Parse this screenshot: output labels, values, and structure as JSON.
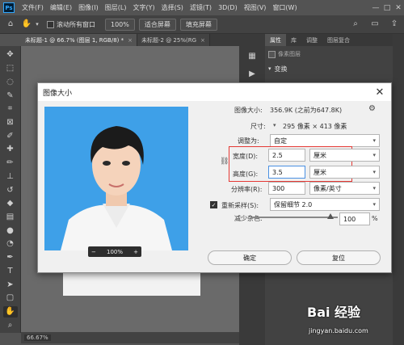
{
  "menubar": {
    "logo": "Ps",
    "items": [
      "文件(F)",
      "编辑(E)",
      "图像(I)",
      "图层(L)",
      "文字(Y)",
      "选择(S)",
      "滤镜(T)",
      "3D(D)",
      "视图(V)",
      "窗口(W)"
    ],
    "win_controls": [
      "—",
      "□",
      "✕"
    ]
  },
  "optbar": {
    "scroll_all_label": "滚动所有窗口",
    "zoom_value": "100%",
    "fit_screen": "适合屏幕",
    "fill_screen": "填充屏幕"
  },
  "tabs": [
    {
      "label": "未标题-1 @ 66.7% (图层 1, RGB/8) *",
      "close": "×"
    },
    {
      "label": "未标题-2 @ 25%(RG",
      "close": "×"
    }
  ],
  "panel": {
    "tabs": [
      "属性",
      "库",
      "调整",
      "图层复合"
    ],
    "row1": "像素图层",
    "row2": "变换"
  },
  "statusbar": {
    "zoom": "66.67%"
  },
  "dialog": {
    "title": "图像大小",
    "close": "✕",
    "image_size_label": "图像大小:",
    "image_size_value": "356.9K (之前为647.8K)",
    "dimensions_label": "尺寸:",
    "dimensions_value": "295 像素 × 413 像素",
    "fit_to_label": "调整为:",
    "fit_to_value": "自定",
    "width_label": "宽度(D):",
    "width_value": "2.5",
    "width_unit": "厘米",
    "height_label": "高度(G):",
    "height_value": "3.5",
    "height_unit": "厘米",
    "resolution_label": "分辨率(R):",
    "resolution_value": "300",
    "resolution_unit": "像素/英寸",
    "resample_label": "重新采样(S):",
    "resample_value": "保留细节 2.0",
    "noise_label": "减少杂色:",
    "noise_value": "100",
    "noise_unit": "%",
    "noise_level": 0.92,
    "ok": "确定",
    "reset": "复位",
    "preview_zoom": "100%",
    "zoom_minus": "−",
    "zoom_plus": "+"
  },
  "watermark": {
    "main": "Bai 经验",
    "sub": "jingyan.baidu.com"
  },
  "colors": {
    "dialog_bg": "#f0f0f0",
    "highlight": "#e53935",
    "preview_bg": "#3ea0e8",
    "ps_dark": "#535353"
  }
}
